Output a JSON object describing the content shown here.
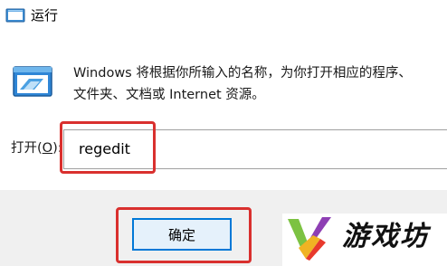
{
  "window": {
    "title": "运行",
    "title_icon": "run-icon"
  },
  "body": {
    "icon": "run-program-icon",
    "description_line1": "Windows 将根据你所输入的名称，为你打开相应的程序、",
    "description_line2": "文件夹、文档或 Internet 资源。",
    "open_label_prefix": "打开(",
    "open_label_accel": "O",
    "open_label_suffix": "):",
    "open_value": "regedit"
  },
  "footer": {
    "ok_label": "确定"
  },
  "watermark": {
    "text": "游戏坊"
  },
  "colors": {
    "highlight": "#d9302e",
    "button_border": "#0078d7",
    "button_fill": "#e5f1fb",
    "footer_bg": "#f0f0f0"
  }
}
